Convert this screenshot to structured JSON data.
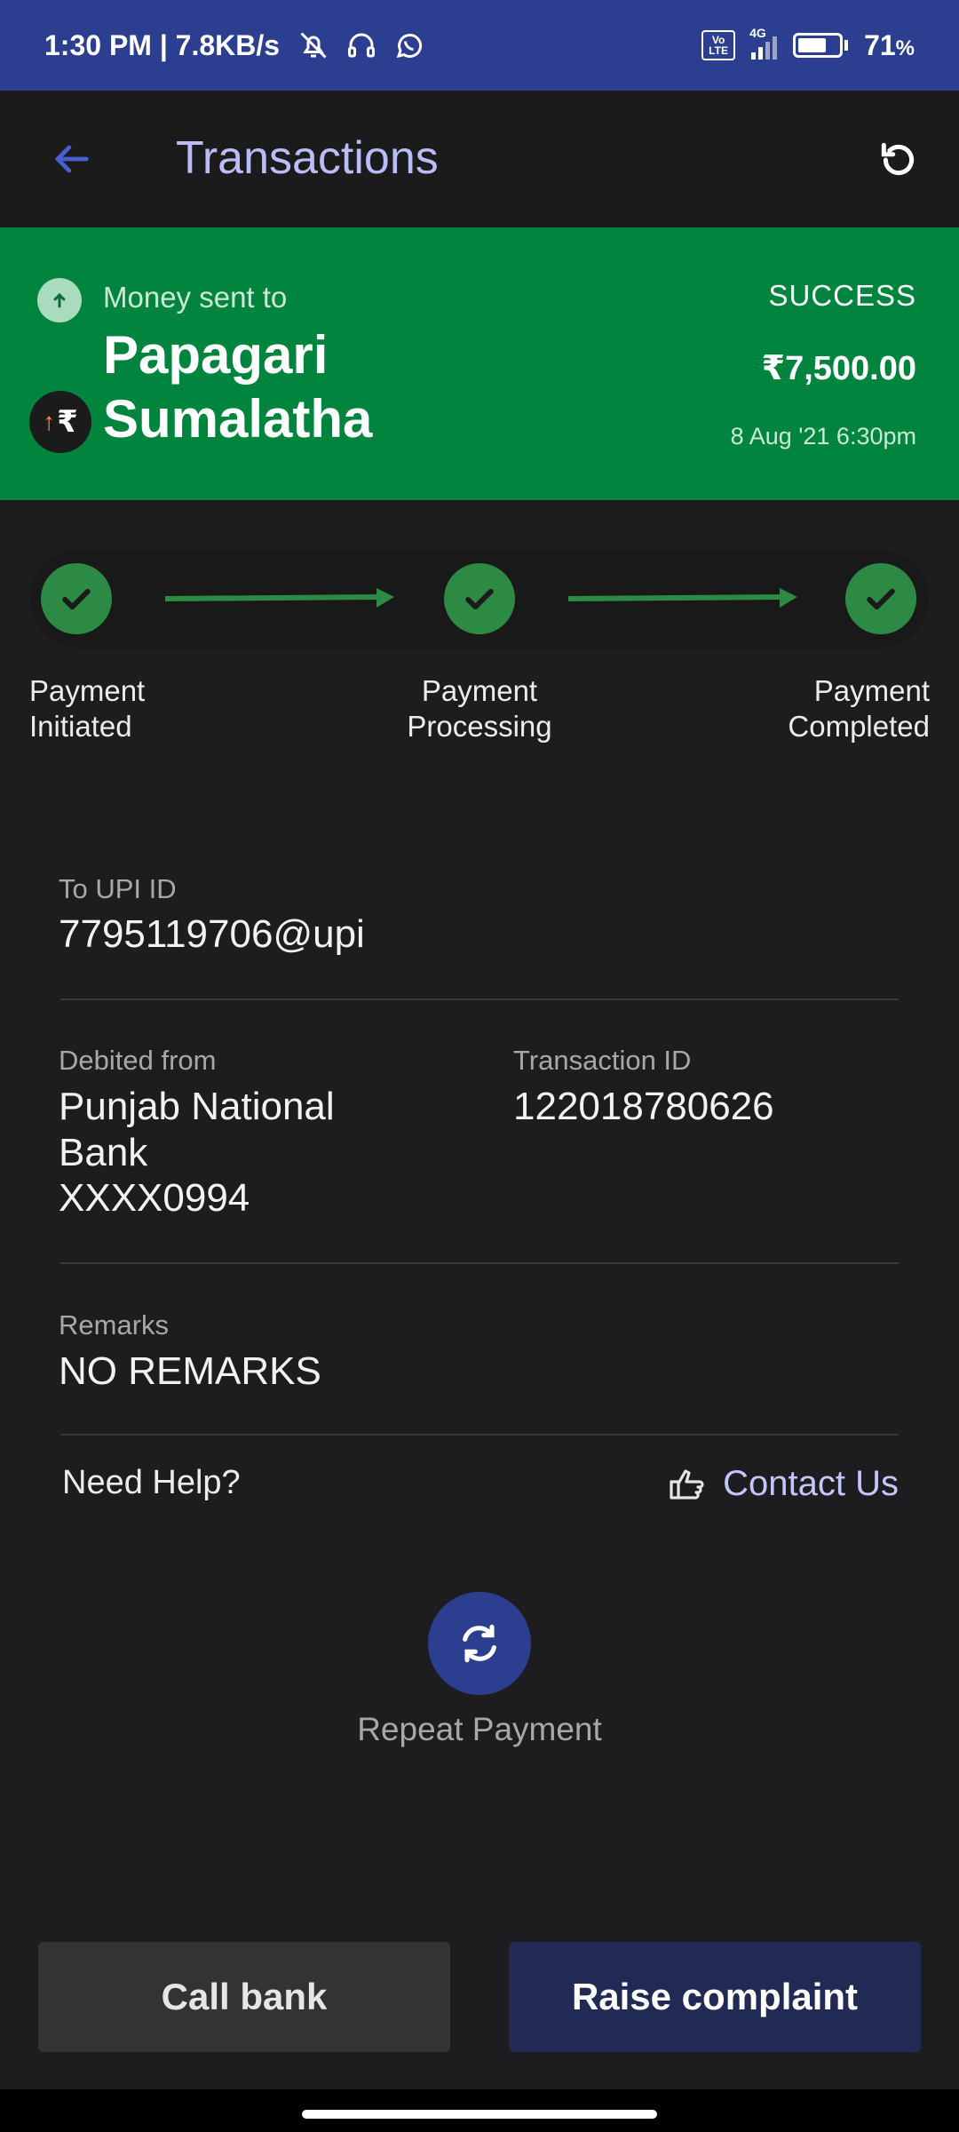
{
  "status_bar": {
    "time_speed": "1:30 PM | 7.8KB/s",
    "network": "4G",
    "volte": "Vo LTE",
    "battery": "71",
    "battery_unit": "%",
    "battery_level": 0.71
  },
  "app_bar": {
    "title": "Transactions",
    "back_icon": "arrow-left-icon",
    "refresh_icon": "refresh-icon"
  },
  "banner": {
    "label": "Money sent to",
    "payee": "Papagari Sumalatha",
    "status": "SUCCESS",
    "amount": "₹7,500.00",
    "datetime": "8 Aug '21 6:30pm",
    "avatar_symbol": "₹",
    "avatar_arrow": "↑",
    "color": "#01853e"
  },
  "progress": {
    "steps": [
      {
        "label": "Payment Initiated",
        "done": true
      },
      {
        "label": "Payment Processing",
        "done": true
      },
      {
        "label": "Payment Completed",
        "done": true
      }
    ],
    "color": "#2c8a45"
  },
  "details": {
    "upi_label": "To UPI ID",
    "upi_value": "7795119706@upi",
    "debited_label": "Debited from",
    "debited_bank": "Punjab National Bank",
    "debited_account": "XXXX0994",
    "txn_label": "Transaction ID",
    "txn_value": "122018780626",
    "remarks_label": "Remarks",
    "remarks_value": "NO REMARKS"
  },
  "help": {
    "label": "Need Help?",
    "contact_label": "Contact Us",
    "contact_icon": "hand-pointer-icon"
  },
  "repeat": {
    "label": "Repeat Payment",
    "icon": "repeat-icon"
  },
  "actions": {
    "call_bank": "Call bank",
    "raise_complaint": "Raise complaint"
  }
}
